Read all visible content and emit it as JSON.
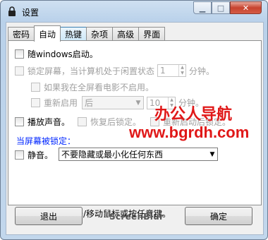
{
  "window": {
    "title": "设置"
  },
  "tabs": [
    {
      "label": "密码"
    },
    {
      "label": "自动"
    },
    {
      "label": "热键"
    },
    {
      "label": "杂项"
    },
    {
      "label": "高级"
    },
    {
      "label": "界面"
    }
  ],
  "auto": {
    "startup_label": "随windows启动。",
    "lock_label": "锁定屏幕，当计算机处于闲置状态",
    "lock_minutes_value": "1",
    "lock_minutes_unit": "分钟。",
    "fullscreen_label": "如果我在全屏看电影不启用。",
    "reenable_label": "重新启用",
    "reenable_select": "后",
    "reenable_minutes_value": "10",
    "reenable_minutes_unit": "分钟。",
    "sound_label": "播放声音。",
    "restore_lock_label": "恢复后锁定。",
    "restart_lock_label": "重新启动后锁定。",
    "when_locked_label": "当屏幕被锁定：",
    "mute_label": "静音。",
    "window_option_select": "不要隐藏或最小化任何东西"
  },
  "hint_text": "空闲是当你不点击/移动鼠标或按任意键。",
  "buttons": {
    "exit": "退出",
    "ok": "确定"
  },
  "brand": "ScreenBlur",
  "watermark": {
    "line1": "办公人导航",
    "line2": "www.bgrdh.com"
  },
  "colors": {
    "link": "#0026ff",
    "watermark": "#e01818"
  }
}
